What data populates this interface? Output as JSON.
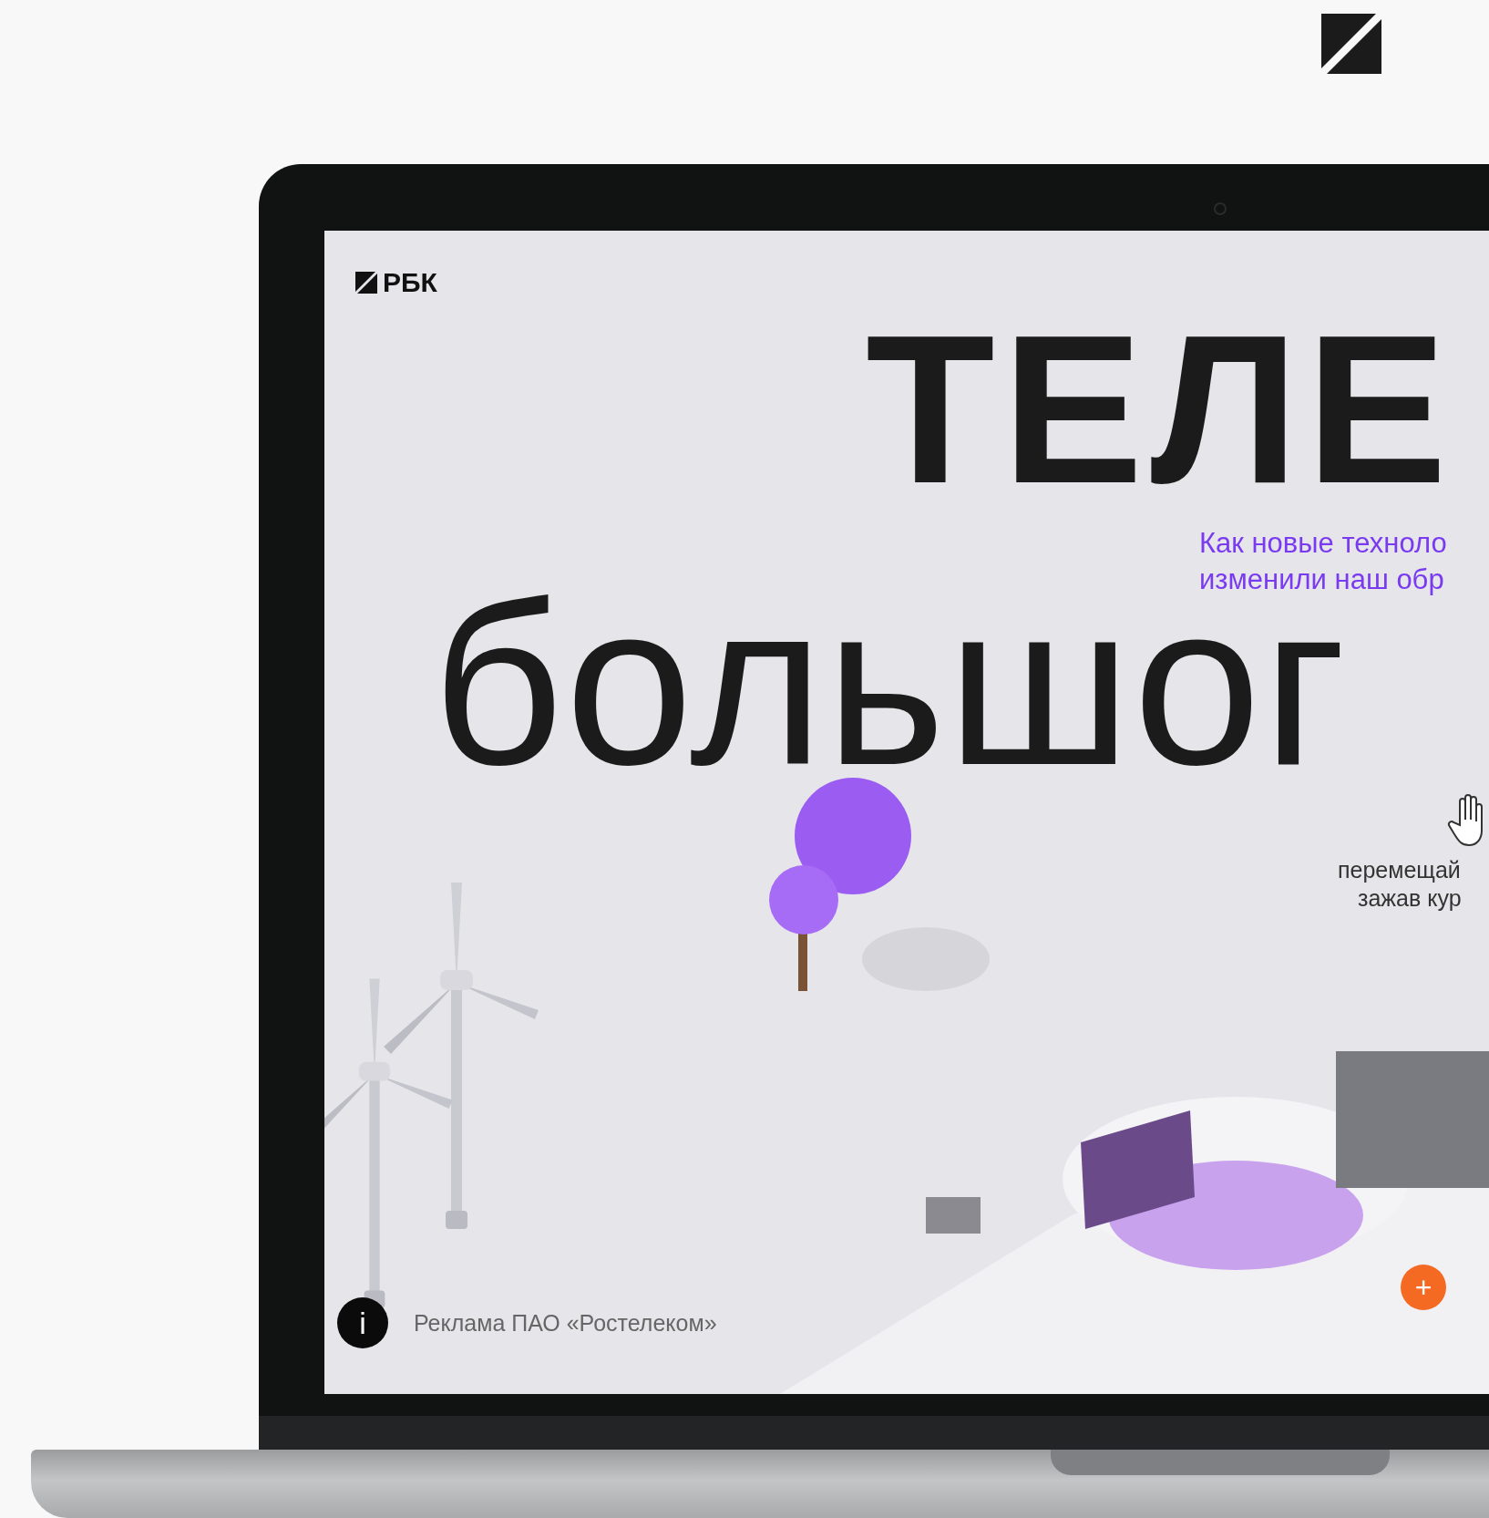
{
  "laptop_screen": {
    "logo_text": "РБК",
    "headline": "ТЕЛЕ",
    "subtitle": [
      "Как новые техноло",
      "изменили наш обр"
    ],
    "big_word": "большог",
    "hint": [
      "перемещай",
      "зажав кур"
    ],
    "info_button": "i",
    "ad_label": "Реклама ПАО «Ростелеком»",
    "plus_button": "+"
  }
}
